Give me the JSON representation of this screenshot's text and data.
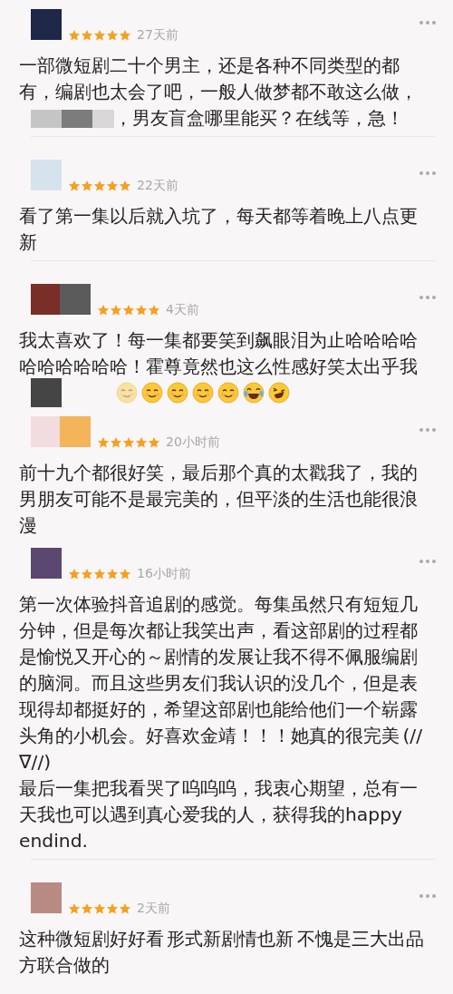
{
  "comments": [
    {
      "avatar": {
        "color": "#1d2747"
      },
      "stars": 5,
      "time": "27天前",
      "text": "一部微短剧二十个男主，还是各种不同类型的都有，编剧也太会了吧，一般人做梦都不敢这么做，",
      "covered_line": {
        "text": "，男友盲盒哪里能买？在线等，急！"
      },
      "emoji_line": false,
      "divider": true
    },
    {
      "avatar": {
        "color": "#d6e3ec"
      },
      "stars": 5,
      "time": "22天前",
      "text": "看了第一集以后就入坑了，每天都等着晚上八点更新",
      "emoji_line": false,
      "divider": true
    },
    {
      "avatar": {
        "color": "#7a2e28"
      },
      "cover": {
        "color": "#5b5b5b"
      },
      "stars": 5,
      "time": "4天前",
      "text": "我太喜欢了！每一集都要笑到飙眼泪为止哈哈哈哈哈哈哈哈哈哈！霍尊竟然也这么性感好笑太出乎我",
      "emoji_line": true,
      "divider": false
    },
    {
      "avatar": {
        "color": "#f3dcdf"
      },
      "cover": {
        "color": "#f3b45a"
      },
      "stars": 5,
      "time": "20小时前",
      "text": "前十九个都很好笑，最后那个真的太戳我了，我的男朋友可能不是最完美的，但平淡的生活也能很浪漫",
      "emoji_line": false,
      "divider": false
    },
    {
      "avatar": {
        "color": "#5b4870"
      },
      "stars": 5,
      "time": "16小时前",
      "text": "第一次体验抖音追剧的感觉。每集虽然只有短短几分钟，但是每次都让我笑出声，看这部剧的过程都是愉悦又开心的～剧情的发展让我不得不佩服编剧的脑洞。而且这些男友们我认识的没几个，但是表现得却都挺好的，希望这部剧也能给他们一个崭露头角的小机会。好喜欢金靖！！！她真的很完美 (//∇//)\n最后一集把我看哭了呜呜呜，我衷心期望，总有一天我也可以遇到真心爱我的人，获得我的happy endind.",
      "emoji_line": false,
      "divider": true
    },
    {
      "avatar": {
        "color": "#b88a84"
      },
      "stars": 5,
      "time": "2天前",
      "text": "这种微短剧好好看 形式新剧情也新 不愧是三大出品方联合做的",
      "emoji_line": false,
      "divider": false
    }
  ]
}
